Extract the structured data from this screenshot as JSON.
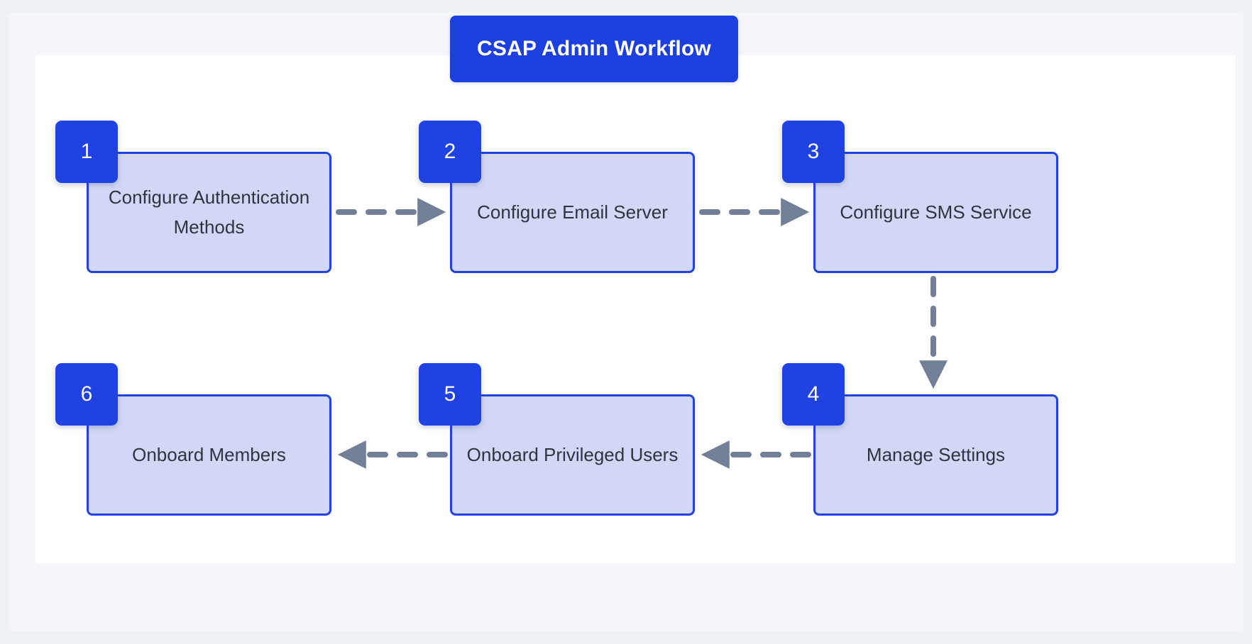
{
  "diagram": {
    "title": "CSAP Admin Workflow",
    "type": "flowchart",
    "accent_color": "#1f42e0",
    "title_banner_color": "#1d3fdd",
    "node_fill_color": "#d2d7f5",
    "node_border_color": "#1f42e0",
    "node_text_color": "#2e3440",
    "connector_color": "#718096",
    "canvas_color": "#ffffff",
    "frame_color": "#f5f6fa",
    "page_background_color": "#eef1f5",
    "nodes": [
      {
        "number": "1",
        "label": "Configure Authentication Methods"
      },
      {
        "number": "2",
        "label": "Configure Email Server"
      },
      {
        "number": "3",
        "label": "Configure SMS Service"
      },
      {
        "number": "4",
        "label": "Manage Settings"
      },
      {
        "number": "5",
        "label": "Onboard Privileged Users"
      },
      {
        "number": "6",
        "label": "Onboard Members"
      }
    ],
    "connectors": [
      {
        "from": "1",
        "to": "2",
        "direction": "right",
        "style": "dashed"
      },
      {
        "from": "2",
        "to": "3",
        "direction": "right",
        "style": "dashed"
      },
      {
        "from": "3",
        "to": "4",
        "direction": "down",
        "style": "dashed"
      },
      {
        "from": "4",
        "to": "5",
        "direction": "left",
        "style": "dashed"
      },
      {
        "from": "5",
        "to": "6",
        "direction": "left",
        "style": "dashed"
      }
    ]
  }
}
